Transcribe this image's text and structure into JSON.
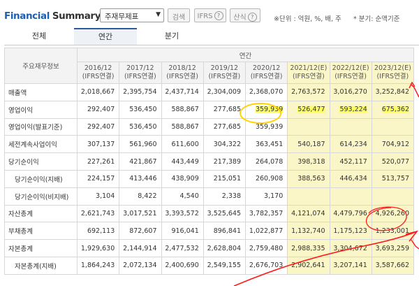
{
  "header": {
    "title_part1": "Financial",
    "title_part2": "Summary",
    "select_value": "주재무제표",
    "search_button": "검색",
    "ifrs_button": "IFRS",
    "formula_button": "산식",
    "unit_note": "※단위 : 억원, %, 배, 주",
    "period_note": "* 분기: 순액기준"
  },
  "tabs": [
    "전체",
    "연간",
    "분기"
  ],
  "table": {
    "corner_label": "주요재무정보",
    "group_label": "연간",
    "columns": [
      {
        "year": "2016/12",
        "basis": "(IFRS연결)"
      },
      {
        "year": "2017/12",
        "basis": "(IFRS연결)"
      },
      {
        "year": "2018/12",
        "basis": "(IFRS연결)"
      },
      {
        "year": "2019/12",
        "basis": "(IFRS연결)"
      },
      {
        "year": "2020/12",
        "basis": "(IFRS연결)"
      },
      {
        "year": "2021/12(E)",
        "basis": "(IFRS연결)"
      },
      {
        "year": "2022/12(E)",
        "basis": "(IFRS연결)"
      },
      {
        "year": "2023/12(E)",
        "basis": "(IFRS연결)"
      }
    ],
    "rows": [
      {
        "label": "매출액",
        "values": [
          "2,018,667",
          "2,395,754",
          "2,437,714",
          "2,304,009",
          "2,368,070",
          "2,763,572",
          "3,016,270",
          "3,252,842"
        ]
      },
      {
        "label": "영업이익",
        "values": [
          "292,407",
          "536,450",
          "588,867",
          "277,685",
          "359,939",
          "526,477",
          "593,224",
          "675,362"
        ]
      },
      {
        "label": "영업이익(발표기준)",
        "values": [
          "292,407",
          "536,450",
          "588,867",
          "277,685",
          "359,939",
          "",
          "",
          ""
        ]
      },
      {
        "label": "세전계속사업이익",
        "values": [
          "307,137",
          "561,960",
          "611,600",
          "304,322",
          "363,451",
          "540,187",
          "614,234",
          "704,912"
        ]
      },
      {
        "label": "당기순이익",
        "values": [
          "227,261",
          "421,867",
          "443,449",
          "217,389",
          "264,078",
          "398,318",
          "452,117",
          "520,077"
        ]
      },
      {
        "label": "당기순이익(지배)",
        "values": [
          "224,157",
          "413,446",
          "438,909",
          "215,051",
          "260,908",
          "388,563",
          "446,434",
          "513,757"
        ]
      },
      {
        "label": "당기순이익(비지배)",
        "values": [
          "3,104",
          "8,422",
          "4,540",
          "2,338",
          "3,170",
          "",
          "",
          ""
        ]
      },
      {
        "label": "자산총계",
        "values": [
          "2,621,743",
          "3,017,521",
          "3,393,572",
          "3,525,645",
          "3,782,357",
          "4,121,074",
          "4,479,796",
          "4,926,260"
        ]
      },
      {
        "label": "부채총계",
        "values": [
          "692,113",
          "872,607",
          "916,041",
          "896,841",
          "1,022,877",
          "1,132,740",
          "1,175,123",
          "1,233,001"
        ]
      },
      {
        "label": "자본총계",
        "values": [
          "1,929,630",
          "2,144,914",
          "2,477,532",
          "2,628,804",
          "2,759,480",
          "2,988,335",
          "3,304,672",
          "3,693,259"
        ]
      },
      {
        "label": "자본총계(지배)",
        "values": [
          "1,864,243",
          "2,072,134",
          "2,400,690",
          "2,549,155",
          "2,676,703",
          "2,902,641",
          "3,207,141",
          "3,587,662"
        ]
      }
    ]
  }
}
